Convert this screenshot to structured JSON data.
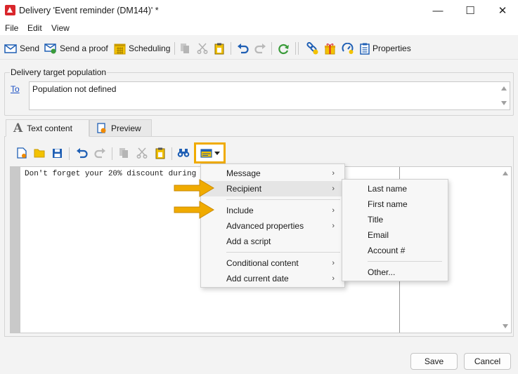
{
  "window": {
    "title": "Delivery 'Event reminder (DM144)' *",
    "minimize_glyph": "—",
    "maximize_glyph": "☐",
    "close_glyph": "✕"
  },
  "menubar": {
    "items": [
      "File",
      "Edit",
      "View"
    ]
  },
  "toolbar": {
    "send": "Send",
    "send_proof": "Send a proof",
    "scheduling": "Scheduling",
    "properties": "Properties"
  },
  "target": {
    "group_label": "Delivery target population",
    "to_link": "To",
    "population_value": "Population not defined"
  },
  "tabs": {
    "text_content": "Text content",
    "preview": "Preview",
    "text_content_glyph": "A"
  },
  "editor": {
    "content": "Don't forget your 20% discount during the event"
  },
  "insert_menu": {
    "items": [
      {
        "label": "Message",
        "submenu": true
      },
      {
        "label": "Recipient",
        "submenu": true
      },
      {
        "label": "Include",
        "submenu": true
      },
      {
        "label": "Advanced properties",
        "submenu": true
      },
      {
        "label": "Add a script",
        "submenu": false
      },
      {
        "label": "Conditional content",
        "submenu": true
      },
      {
        "label": "Add current date",
        "submenu": true
      }
    ]
  },
  "recipient_submenu": {
    "items": [
      "Last name",
      "First name",
      "Title",
      "Email",
      "Account #"
    ],
    "other": "Other..."
  },
  "footer": {
    "save": "Save",
    "cancel": "Cancel"
  },
  "colors": {
    "highlight": "#f0ab00",
    "link": "#1a4fc4",
    "brand_red": "#d9262b",
    "icon_blue": "#1f5fb4",
    "icon_green": "#3a9b3a"
  },
  "icons": {
    "app": "adobe-campaign-icon",
    "send": "envelope-send-icon",
    "send_proof": "envelope-proof-icon",
    "scheduling": "calendar-icon",
    "copy": "copy-icon",
    "cut": "scissors-icon",
    "paste": "paste-icon",
    "undo": "undo-icon",
    "redo": "redo-icon",
    "refresh": "refresh-icon",
    "link": "link-icon",
    "gift": "gift-icon",
    "tracking": "tracking-icon",
    "properties": "clipboard-icon",
    "new": "new-document-icon",
    "open": "folder-open-icon",
    "save": "save-disk-icon",
    "find": "binoculars-icon",
    "insert": "insert-field-icon",
    "chevron": "›"
  }
}
